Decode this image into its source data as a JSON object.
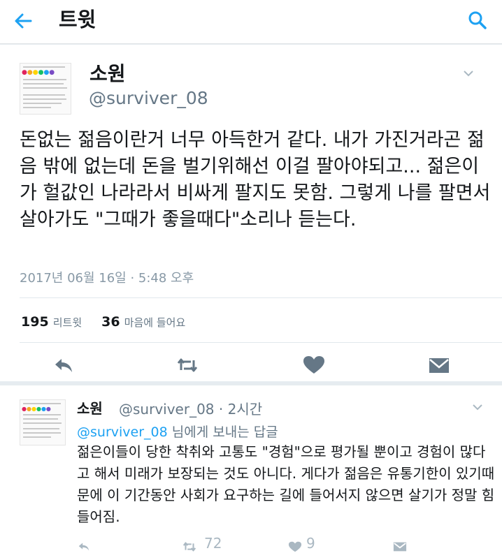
{
  "header": {
    "title": "트윗"
  },
  "tweet": {
    "name": "소원",
    "handle": "@surviver_08",
    "text": "돈없는 젊음이란거 너무 아득한거 같다. 내가 가진거라곤 젊음 밖에 없는데 돈을 벌기위해선 이걸 팔아야되고... 젊은이가 헐값인 나라라서 비싸게 팔지도 못함. 그렇게 나를 팔면서 살아가도 \"그때가 좋을때다\"소리나 듣는다.",
    "date": "2017년 06월 16일 · 5:48 오후",
    "retweet_count": "195",
    "retweet_label": "리트윗",
    "like_count": "36",
    "like_label": "마음에 들어요"
  },
  "reply": {
    "name": "소원",
    "meta": "@surviver_08 · 2시간",
    "reply_mention": "@surviver_08",
    "reply_suffix": " 님에게 보내는 답글",
    "text": "젊은이들이 당한 착취와 고통도 \"경험\"으로 평가될 뿐이고 경험이 많다고 해서 미래가 보장되는 것도 아니다. 게다가 젊음은 유통기한이 있기때문에 이 기간동안 사회가 요구하는 길에 들어서지 않으면 살기가 정말 힘들어짐.",
    "retweet_count": "72",
    "like_count": "9"
  },
  "colors": {
    "accent": "#1da1f2",
    "icon": "#657786",
    "muted": "#aab8c2"
  },
  "icons": [
    "back-arrow-icon",
    "search-icon",
    "chevron-down-icon",
    "reply-icon",
    "retweet-icon",
    "heart-icon",
    "direct-message-icon"
  ]
}
